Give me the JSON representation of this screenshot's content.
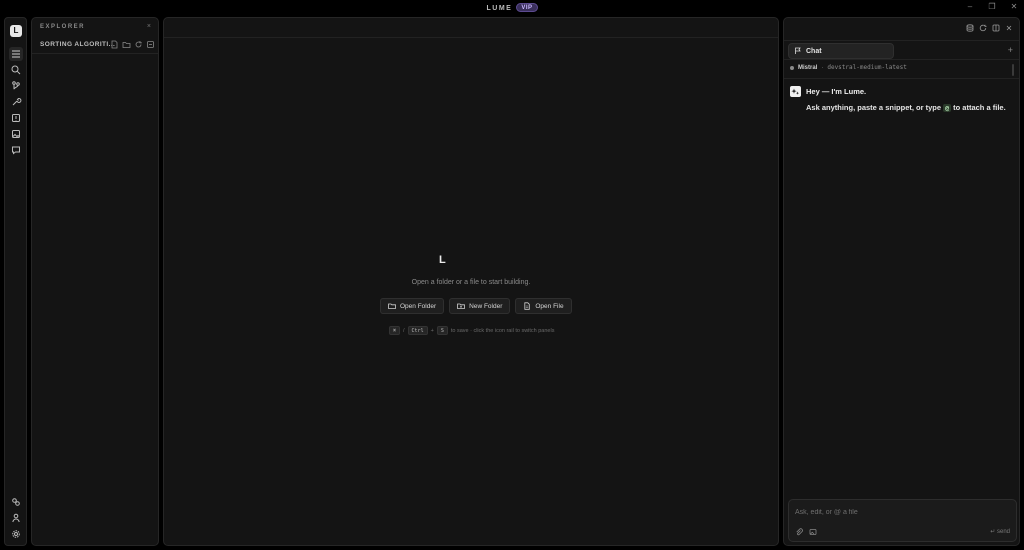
{
  "app": {
    "title": "LUME",
    "badge": "VIP",
    "window_controls": {
      "minimize": "–",
      "restore": "❐",
      "close": "✕"
    }
  },
  "rail": {
    "logo": "L",
    "top_icons": [
      "menu-icon",
      "search-icon",
      "git-branch-icon",
      "wrench-icon",
      "debug-icon",
      "image-icon",
      "comment-icon"
    ],
    "bottom_icons": [
      "link-icon",
      "user-icon",
      "gear-icon"
    ]
  },
  "explorer": {
    "header": "EXPLORER",
    "close": "×",
    "project": "SORTING ALGORITI...",
    "actions": [
      "new-file-icon",
      "new-folder-icon",
      "refresh-icon",
      "collapse-icon"
    ]
  },
  "editor": {
    "logo": "L",
    "hint": "Open a folder or a file to start building.",
    "buttons": {
      "open_folder": "Open Folder",
      "new_folder": "New Folder",
      "open_file": "Open File"
    },
    "shortcuts": {
      "cmd_key": "⌘",
      "slash": "/",
      "ctrl_key": "Ctrl",
      "plus": "+",
      "s_key": "S",
      "description": "to save · click the icon rail to switch panels"
    }
  },
  "chat": {
    "top_icons": [
      "database-icon",
      "history-icon",
      "split-icon",
      "close-icon"
    ],
    "tab_label": "Chat",
    "plus": "+",
    "provider": "Mistral",
    "model_sep": "·",
    "model": "devstral-medium-latest",
    "greeting": "Hey — I'm Lume.",
    "intro": {
      "before": "Ask anything, paste a snippet, or type",
      "at": "@",
      "after": "to attach a file."
    },
    "composer": {
      "placeholder": "Ask, edit, or @ a file",
      "send_label": "↵ send"
    }
  }
}
